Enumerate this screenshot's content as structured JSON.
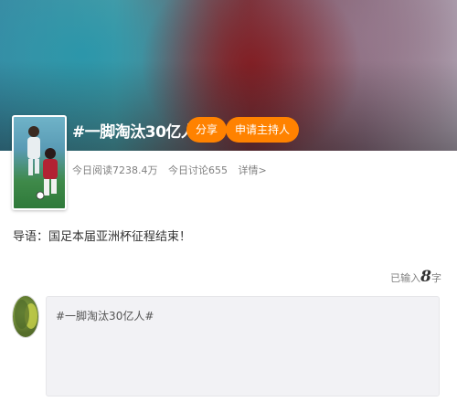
{
  "topic": {
    "title": "#一脚淘汰30亿人#",
    "share_label": "分享",
    "host_label": "申请主持人",
    "stats": {
      "reads": "今日阅读7238.4万",
      "discussions": "今日讨论655",
      "details": "详情>"
    }
  },
  "intro": "导语：国足本届亚洲杯征程结束！",
  "composer": {
    "counter_prefix": "已输入",
    "counter_value": "8",
    "counter_suffix": "字",
    "text": "#一脚淘汰30亿人#"
  },
  "colors": {
    "accent": "#ff8200",
    "muted_text": "#808080",
    "composer_bg": "#f2f2f5"
  }
}
